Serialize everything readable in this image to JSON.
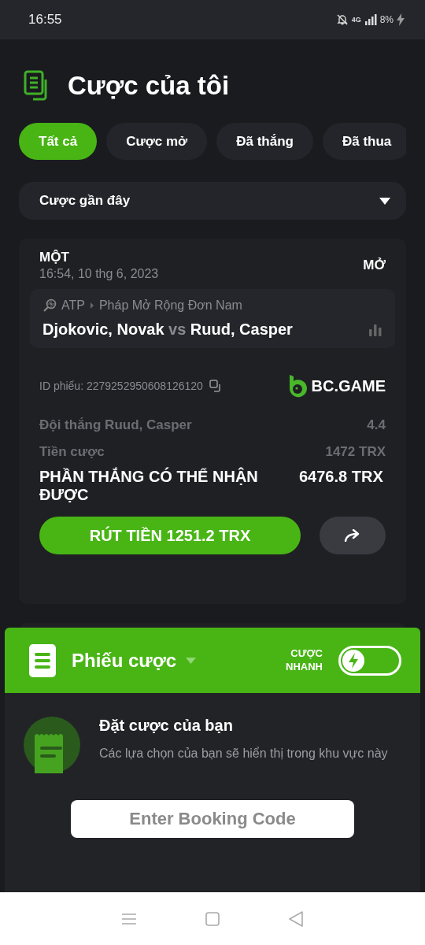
{
  "status_bar": {
    "time": "16:55",
    "battery": "8%",
    "network": "4G"
  },
  "header": {
    "title": "Cược của tôi"
  },
  "tabs": [
    {
      "label": "Tất cả",
      "selected": true
    },
    {
      "label": "Cược mở",
      "selected": false
    },
    {
      "label": "Đã thắng",
      "selected": false
    },
    {
      "label": "Đã thua",
      "selected": false
    }
  ],
  "filter": {
    "value": "Cược gần đây"
  },
  "bet_card": {
    "type": "MỘT",
    "datetime": "16:54, 10 thg 6, 2023",
    "status": "MỞ",
    "league": "ATP",
    "tournament": "Pháp Mở Rộng Đơn Nam",
    "home": "Djokovic, Novak",
    "vs": "vs",
    "away": "Ruud, Casper",
    "ticket_id": "ID phiếu: 2279252950608126120",
    "brand": "BC.GAME",
    "selection": "Đội thắng Ruud, Casper",
    "odds": "4.4",
    "stake_label": "Tiền cược",
    "stake": "1472 TRX",
    "payout_label": "PHẦN THẮNG CÓ THỂ NHẬN ĐƯỢC",
    "payout": "6476.8 TRX",
    "cashout": "RÚT TIỀN 1251.2 TRX"
  },
  "bet_slip": {
    "title": "Phiếu cược",
    "quick_bet_label": "CƯỢC NHANH",
    "quick_bet_on": false,
    "empty_title": "Đặt cược của bạn",
    "empty_text": "Các lựa chọn của bạn sẽ hiển thị trong khu vực này",
    "booking_placeholder": "Enter Booking Code"
  }
}
